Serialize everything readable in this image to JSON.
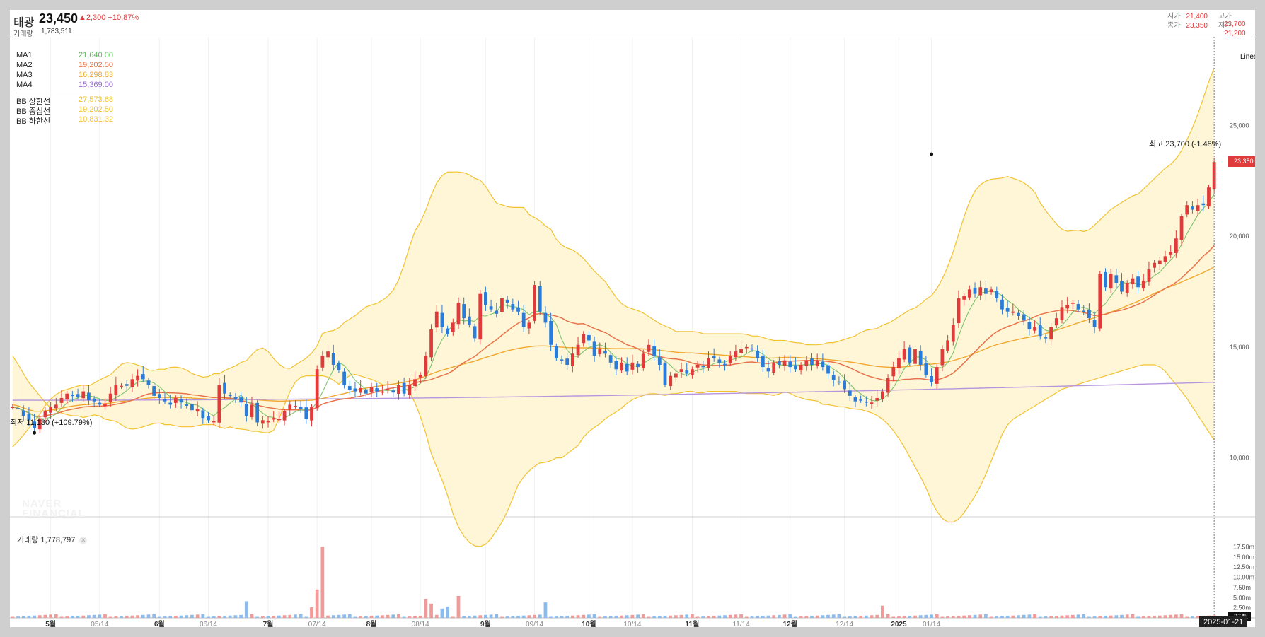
{
  "header": {
    "name": "태광",
    "price": "23,450",
    "change": "▲2,300 +10.87%",
    "volume_label": "거래량",
    "volume_value": "1,783,511",
    "open_label": "시가",
    "open_value": "21,400",
    "high_label": "고가",
    "high_value": "23,700",
    "close_label": "종가",
    "close_value": "23,350",
    "low_label": "저가",
    "low_value": "21,200"
  },
  "legend": [
    {
      "name": "MA1",
      "value": "21,640.00",
      "color": "#5cb85c"
    },
    {
      "name": "MA2",
      "value": "19,202.50",
      "color": "#e8734a"
    },
    {
      "name": "MA3",
      "value": "16,298.83",
      "color": "#f0a830"
    },
    {
      "name": "MA4",
      "value": "15,369.00",
      "color": "#9b6fd0"
    },
    {
      "name": "BB 상한선",
      "value": "27,573.68",
      "color": "#f2c230"
    },
    {
      "name": "BB 중심선",
      "value": "19,202.50",
      "color": "#f2c230"
    },
    {
      "name": "BB 하한선",
      "value": "10,831.32",
      "color": "#f2c230"
    }
  ],
  "scale_mode": "Linear",
  "annotations": {
    "high": "최고 23,700 (-1.48%)",
    "low": "최저 11,130 (+109.79%)"
  },
  "watermark": [
    "NAVER",
    "FINANCIAL"
  ],
  "volume_panel": {
    "label": "거래량 1,778,797",
    "close_icon": "close-icon",
    "last_value_tag": "274k"
  },
  "price_tag": "23,350",
  "date_tag": "2025-01-21",
  "colors": {
    "up": "#e03a3a",
    "down": "#2b7bd8",
    "band_fill": "#fff6d8",
    "band_line": "#f2c230"
  },
  "chart_data": [
    {
      "type": "candlestick",
      "title": "",
      "y_scale": "linear",
      "ylim": [
        7500,
        29000
      ],
      "y_ticks": [
        10000,
        15000,
        20000,
        25000
      ],
      "y_tick_labels": [
        "10,000",
        "15,000",
        "20,000",
        "25,000"
      ],
      "x_tick_labels": [
        "5월",
        "05/14",
        "6월",
        "06/14",
        "7월",
        "07/14",
        "8월",
        "08/14",
        "9월",
        "09/14",
        "10월",
        "10/14",
        "11월",
        "11/14",
        "12월",
        "12/14",
        "2025",
        "01/14"
      ],
      "x_tick_index": [
        7,
        16,
        27,
        36,
        47,
        56,
        66,
        75,
        87,
        96,
        106,
        114,
        125,
        134,
        143,
        153,
        163,
        169
      ],
      "close": [
        12300,
        12200,
        11900,
        11700,
        11350,
        11750,
        12100,
        12300,
        12400,
        12700,
        12900,
        12800,
        12750,
        13000,
        12600,
        12550,
        12400,
        12450,
        12900,
        13300,
        13250,
        13250,
        13550,
        13700,
        13550,
        13300,
        12800,
        12700,
        12550,
        12400,
        12700,
        12500,
        12350,
        12150,
        12200,
        11800,
        11700,
        11650,
        13300,
        12900,
        12800,
        12650,
        12500,
        11900,
        12400,
        11600,
        11700,
        11650,
        11800,
        11750,
        12100,
        12400,
        12350,
        12200,
        11750,
        12300,
        14000,
        14600,
        14800,
        14200,
        13950,
        13300,
        13050,
        13000,
        13150,
        12900,
        13200,
        13000,
        13000,
        13100,
        12950,
        13300,
        12900,
        13300,
        13550,
        13750,
        14600,
        15800,
        16600,
        15900,
        15600,
        16100,
        17000,
        16300,
        16000,
        15400,
        17400,
        16900,
        16700,
        16500,
        17200,
        17000,
        16700,
        16600,
        15900,
        16100,
        17800,
        16600,
        16100,
        15100,
        14500,
        14400,
        14200,
        14700,
        15100,
        15600,
        15300,
        14600,
        14900,
        14700,
        14300,
        14000,
        14300,
        13900,
        14300,
        14100,
        14700,
        15100,
        14600,
        14200,
        13300,
        13700,
        13800,
        14000,
        13800,
        14000,
        14200,
        14100,
        14500,
        14500,
        14300,
        14200,
        14600,
        14800,
        14900,
        15000,
        14900,
        14500,
        14100,
        13900,
        14300,
        14200,
        14400,
        14100,
        14000,
        14200,
        14400,
        14200,
        14400,
        14100,
        13800,
        13500,
        13400,
        13100,
        12800,
        12550,
        12600,
        12500,
        12500,
        12700,
        13000,
        13600,
        14100,
        14500,
        14900,
        14300,
        14900,
        14200,
        13750,
        13400,
        14100,
        14900,
        15300,
        16000,
        17200,
        17300,
        17600,
        17400,
        17700,
        17400,
        17600,
        17200,
        16700,
        16600,
        16600,
        16400,
        16200,
        15800,
        15900,
        15500,
        15400,
        15900,
        16300,
        16800,
        16900,
        17000,
        16700,
        16600,
        16300,
        15900,
        18300,
        17700,
        18300,
        17900,
        17500,
        17900,
        18100,
        17700,
        18000,
        18500,
        18800,
        18900,
        19100,
        19300,
        19900,
        20900,
        21400,
        21200,
        21400,
        21400,
        22200,
        23350
      ],
      "bb_upper": [
        10500,
        10800,
        11200,
        11600,
        12000,
        12500,
        12800,
        13000,
        13100,
        13200,
        13300,
        13250,
        13400,
        13600,
        13700,
        14000,
        14300,
        14300,
        14200,
        14100,
        13900,
        14000,
        14000,
        14100,
        14100,
        14000,
        13800,
        13700,
        13600,
        13800,
        13800,
        14000,
        14100,
        14300,
        14400,
        14800,
        15000,
        14800,
        14400,
        14100,
        14000,
        14200,
        14400,
        14600,
        15000,
        15700,
        15700,
        15800,
        16100,
        16300,
        16500,
        16800,
        16900,
        17000,
        17200,
        17500,
        18100,
        19000,
        20100,
        20600,
        21300,
        22200,
        22700,
        22900,
        22900,
        22900,
        22800,
        22600,
        22500,
        22000,
        21500,
        21400,
        21300,
        21300,
        21300,
        20900,
        20800,
        20500,
        20300,
        19700,
        19500,
        19400,
        19200,
        18900,
        18500,
        18200,
        17900,
        17400,
        17000,
        16800,
        16700,
        16600,
        16400,
        16200,
        16000,
        15900,
        15700,
        15700,
        15700,
        15700,
        15600,
        15600,
        15600,
        15600,
        15600,
        15600,
        15600,
        15500,
        15500,
        15400,
        15300,
        15300,
        15300,
        15200,
        15200,
        15100,
        15100,
        15100,
        15200,
        15200,
        15300,
        15400,
        15500,
        15700,
        15800,
        15800,
        16000,
        16100,
        16300,
        16500,
        16700,
        16800,
        17100,
        17300,
        17700,
        18300,
        19100,
        20100,
        21100,
        21900,
        22300,
        22500,
        22600,
        22600,
        22700,
        22600,
        22500,
        22300,
        22000,
        21400,
        21000,
        20600,
        20300,
        20200,
        20300,
        20200,
        20300,
        20600,
        20900,
        21200,
        21400,
        21600,
        21800,
        21900,
        22200,
        22500,
        22800,
        23100,
        23300,
        23700,
        24300,
        25000,
        25800,
        26800,
        27600
      ],
      "bb_mid": [
        12500,
        12400,
        12300,
        12350,
        12350,
        12400,
        12450,
        12500,
        12500,
        12550,
        12550,
        12600,
        12650,
        12650,
        12700,
        12750,
        12800,
        12800,
        12800,
        12800,
        12750,
        12750,
        12750,
        12750,
        12750,
        12700,
        12650,
        12600,
        12550,
        12550,
        12600,
        12650,
        12700,
        12750,
        12800,
        12950,
        13100,
        13350,
        13600,
        13750,
        13850,
        13950,
        14050,
        14150,
        14300,
        14500,
        14650,
        14800,
        14900,
        14950,
        15000,
        15050,
        15100,
        15150,
        15200,
        15200,
        15150,
        15100,
        15050,
        14950,
        14850,
        14750,
        14650,
        14550,
        14450,
        14350,
        14300,
        14250,
        14250,
        14200,
        14200,
        14200,
        14200,
        14250,
        14300,
        14350,
        14400,
        14450,
        14500,
        14500,
        14500,
        14550,
        14600,
        14600,
        14650,
        14700,
        14700,
        14700,
        14650,
        14600,
        14550,
        14500,
        14450,
        14400,
        14350,
        14300,
        14250,
        14250,
        14300,
        14400,
        14500,
        14600,
        14700,
        14850,
        15000,
        15200,
        15400,
        15600,
        15700,
        15800,
        15900,
        16000,
        16100,
        16250,
        16400,
        16500,
        16600,
        16700,
        16800,
        16900,
        17000,
        17200,
        17400,
        17600,
        17800,
        18000,
        18200,
        18400,
        18600,
        18800,
        19000,
        19200
      ],
      "bb_lower": [
        14600,
        14100,
        13500,
        13100,
        12700,
        12300,
        12100,
        12000,
        11900,
        11900,
        11800,
        11950,
        11900,
        11700,
        11700,
        11500,
        11300,
        11300,
        11400,
        11500,
        11600,
        11500,
        11500,
        11400,
        11400,
        11400,
        11500,
        11500,
        11500,
        11300,
        11400,
        11300,
        11300,
        11200,
        11200,
        11100,
        11200,
        11900,
        12800,
        13400,
        13700,
        13700,
        13700,
        13700,
        13600,
        13300,
        13600,
        13800,
        13700,
        13600,
        13500,
        13300,
        13300,
        13300,
        13200,
        12900,
        12200,
        11200,
        10000,
        9300,
        8400,
        7300,
        6600,
        6200,
        6000,
        6000,
        6300,
        6800,
        7300,
        8100,
        8900,
        9300,
        9600,
        9800,
        9800,
        10000,
        10000,
        10300,
        10500,
        11000,
        11300,
        11500,
        11800,
        12000,
        12200,
        12500,
        12700,
        12800,
        12900,
        12900,
        12800,
        12900,
        12900,
        13000,
        13000,
        12900,
        13000,
        13000,
        13000,
        13000,
        13000,
        12900,
        12900,
        12900,
        12900,
        12800,
        12900,
        13000,
        12800,
        12700,
        12600,
        12600,
        12400,
        12400,
        12300,
        12300,
        12200,
        12200,
        12100,
        12000,
        11800,
        11500,
        11100,
        10600,
        10000,
        9400,
        8800,
        8000,
        7400,
        7100,
        7100,
        7300,
        7800,
        8300,
        8900,
        9700,
        10500,
        11300,
        11700,
        11900,
        12100,
        12300,
        12500,
        12700,
        12900,
        13100,
        13200,
        13300,
        13400,
        13500,
        13600,
        13700,
        13800,
        13900,
        14000,
        14100,
        14200,
        14200,
        14200,
        14000,
        13600,
        13200,
        12800,
        12300,
        11800,
        11300,
        10800
      ],
      "volume_ylim": [
        0,
        20000000
      ],
      "volume_ticks_labels": [
        "2.50m",
        "5.00m",
        "7.50m",
        "10.00m",
        "12.50m",
        "15.00m",
        "17.50m"
      ],
      "volume_spikes": [
        {
          "i": 43,
          "v": 4100000
        },
        {
          "i": 55,
          "v": 2600000
        },
        {
          "i": 56,
          "v": 7000000
        },
        {
          "i": 57,
          "v": 17500000
        },
        {
          "i": 76,
          "v": 4700000
        },
        {
          "i": 77,
          "v": 3500000
        },
        {
          "i": 79,
          "v": 2300000
        },
        {
          "i": 80,
          "v": 2800000
        },
        {
          "i": 82,
          "v": 5400000
        },
        {
          "i": 98,
          "v": 3800000
        },
        {
          "i": 160,
          "v": 3000000
        }
      ],
      "annotations": [
        {
          "label": "최고 23,700 (-1.48%)",
          "index": 169,
          "value": 23700
        },
        {
          "label": "최저 11,130 (+109.79%)",
          "index": 4,
          "value": 11130
        }
      ]
    }
  ]
}
